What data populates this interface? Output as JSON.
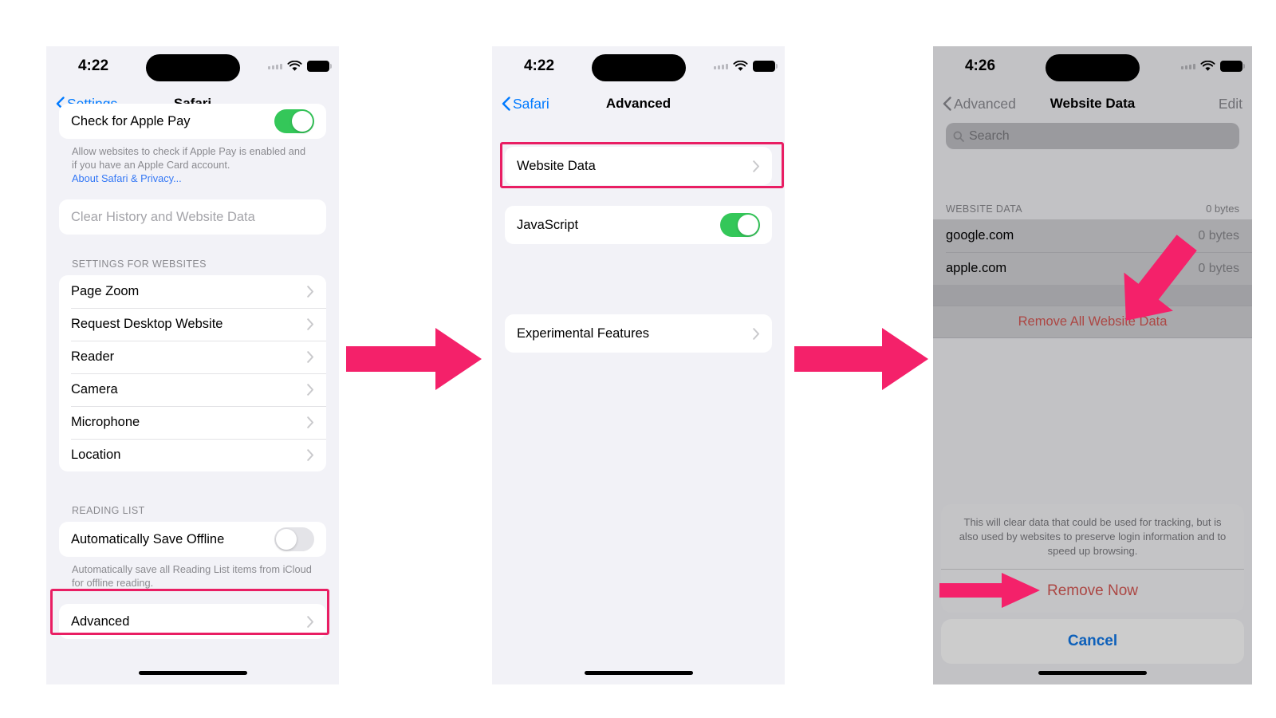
{
  "accent": {
    "highlight_pink": "#e91e63",
    "arrow_pink": "#f4216a",
    "ios_blue": "#007aff",
    "ios_green": "#34c759",
    "ios_red": "#e8544f"
  },
  "screens": [
    {
      "id": "safari-settings",
      "status": {
        "time": "4:22",
        "signal_icon": "signal-dots-icon",
        "wifi_icon": "wifi-icon",
        "battery_icon": "battery-icon"
      },
      "nav": {
        "back_label": "Settings",
        "title": "Safari"
      },
      "apple_pay_row": {
        "label": "Check for Apple Pay",
        "toggle": "on"
      },
      "apple_pay_footnote": "Allow websites to check if Apple Pay is enabled and if you have an Apple Card account.",
      "apple_pay_link": "About Safari & Privacy...",
      "clear_history_label": "Clear History and Website Data",
      "settings_header": "SETTINGS FOR WEBSITES",
      "settings_rows": [
        {
          "label": "Page Zoom"
        },
        {
          "label": "Request Desktop Website"
        },
        {
          "label": "Reader"
        },
        {
          "label": "Camera"
        },
        {
          "label": "Microphone"
        },
        {
          "label": "Location"
        }
      ],
      "reading_header": "READING LIST",
      "auto_save_row": {
        "label": "Automatically Save Offline",
        "toggle": "off"
      },
      "reading_footnote": "Automatically save all Reading List items from iCloud for offline reading.",
      "advanced_label": "Advanced"
    },
    {
      "id": "advanced",
      "status": {
        "time": "4:22"
      },
      "nav": {
        "back_label": "Safari",
        "title": "Advanced"
      },
      "website_data_label": "Website Data",
      "javascript_row": {
        "label": "JavaScript",
        "toggle": "on"
      },
      "experimental_label": "Experimental Features"
    },
    {
      "id": "website-data",
      "status": {
        "time": "4:26"
      },
      "nav": {
        "back_label": "Advanced",
        "title": "Website Data",
        "right_label": "Edit"
      },
      "search": {
        "placeholder": "Search",
        "icon": "magnifier-icon"
      },
      "list_header": {
        "label": "WEBSITE DATA",
        "total": "0 bytes"
      },
      "sites": [
        {
          "domain": "google.com",
          "size": "0 bytes"
        },
        {
          "domain": "apple.com",
          "size": "0 bytes"
        }
      ],
      "remove_all_label": "Remove All Website Data",
      "sheet": {
        "message": "This will clear data that could be used for tracking, but is also used by websites to preserve login information and to speed up browsing.",
        "confirm_label": "Remove Now",
        "cancel_label": "Cancel"
      }
    }
  ],
  "annotations": {
    "arrow_1_name": "step-arrow-1",
    "arrow_2_name": "step-arrow-2",
    "arrow_remove_all_name": "callout-arrow-remove-all",
    "arrow_remove_now_name": "callout-arrow-remove-now"
  }
}
